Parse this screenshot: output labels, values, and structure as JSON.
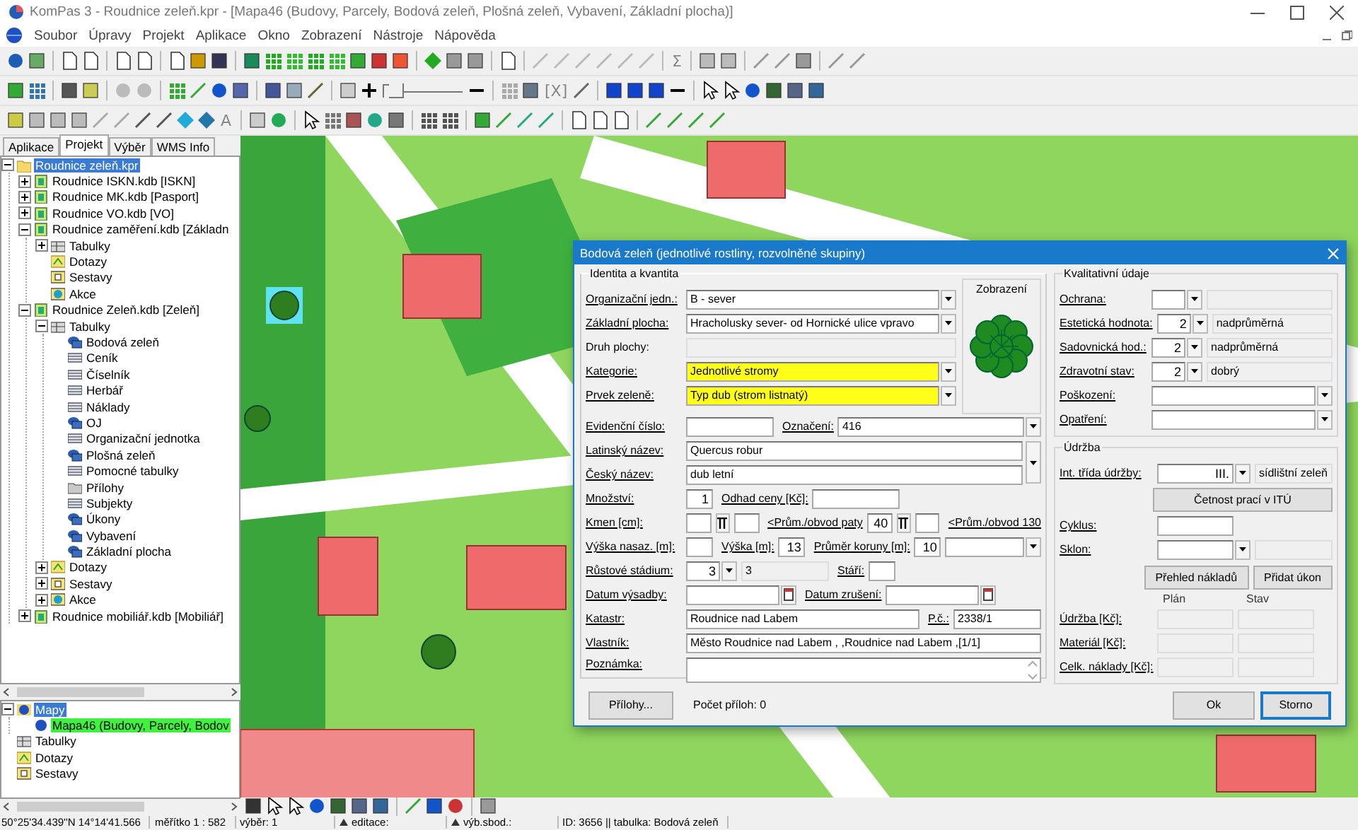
{
  "window": {
    "title": "KomPas 3 - Roudnice zeleň.kpr - [Mapa46 (Budovy, Parcely, Bodová zeleň, Plošná zeleň, Vybavení, Základní plocha)]"
  },
  "menu": [
    "Soubor",
    "Úpravy",
    "Projekt",
    "Aplikace",
    "Okno",
    "Zobrazení",
    "Nástroje",
    "Nápověda"
  ],
  "toolbars": [
    {
      "glyphs": [
        "Σ"
      ]
    },
    {
      "glyphs": [
        "[X]"
      ]
    },
    {
      "glyphs": [
        "A"
      ]
    }
  ],
  "tabs": [
    {
      "label": "Aplikace",
      "selected": false
    },
    {
      "label": "Projekt",
      "selected": true
    },
    {
      "label": "Výběr",
      "selected": false
    },
    {
      "label": "WMS Info",
      "selected": false
    }
  ],
  "project_tree": [
    {
      "label": "Roudnice zeleň.kpr",
      "kind": "folder",
      "expanded": true,
      "selected": true,
      "children": [
        {
          "label": "Roudnice ISKN.kdb [ISKN]",
          "kind": "database",
          "expanded": false,
          "selected": false
        },
        {
          "label": "Roudnice MK.kdb [Pasport]",
          "kind": "database",
          "expanded": false,
          "selected": false
        },
        {
          "label": "Roudnice VO.kdb [VO]",
          "kind": "database",
          "expanded": false,
          "selected": false
        },
        {
          "label": "Roudnice zaměření.kdb [Základn",
          "kind": "database",
          "expanded": true,
          "selected": false,
          "children": [
            {
              "label": "Tabulky",
              "kind": "tables",
              "expanded": false,
              "selected": false
            },
            {
              "label": "Dotazy",
              "kind": "query",
              "selected": false
            },
            {
              "label": "Sestavy",
              "kind": "report",
              "selected": false
            },
            {
              "label": "Akce",
              "kind": "action",
              "selected": false
            }
          ]
        },
        {
          "label": "Roudnice Zeleň.kdb [Zeleň]",
          "kind": "database",
          "expanded": true,
          "selected": false,
          "children": [
            {
              "label": "Tabulky",
              "kind": "tables",
              "expanded": true,
              "selected": false,
              "children": [
                {
                  "label": "Bodová zeleň",
                  "kind": "layer",
                  "selected": false
                },
                {
                  "label": "Ceník",
                  "kind": "table",
                  "selected": false
                },
                {
                  "label": "Číselník",
                  "kind": "table",
                  "selected": false
                },
                {
                  "label": "Herbář",
                  "kind": "table",
                  "selected": false
                },
                {
                  "label": "Náklady",
                  "kind": "table",
                  "selected": false
                },
                {
                  "label": "OJ",
                  "kind": "layer",
                  "selected": false
                },
                {
                  "label": "Organizační jednotka",
                  "kind": "table",
                  "selected": false
                },
                {
                  "label": "Plošná zeleň",
                  "kind": "layer",
                  "selected": false
                },
                {
                  "label": "Pomocné tabulky",
                  "kind": "table",
                  "selected": false
                },
                {
                  "label": "Přílohy",
                  "kind": "attachment",
                  "selected": false
                },
                {
                  "label": "Subjekty",
                  "kind": "table",
                  "selected": false
                },
                {
                  "label": "Úkony",
                  "kind": "layer",
                  "selected": false
                },
                {
                  "label": "Vybavení",
                  "kind": "layer",
                  "selected": false
                },
                {
                  "label": "Základní plocha",
                  "kind": "layer",
                  "selected": false
                }
              ]
            },
            {
              "label": "Dotazy",
              "kind": "query",
              "expanded": false,
              "selected": false
            },
            {
              "label": "Sestavy",
              "kind": "report",
              "expanded": false,
              "selected": false
            },
            {
              "label": "Akce",
              "kind": "action",
              "expanded": false,
              "selected": false
            }
          ]
        },
        {
          "label": "Roudnice mobiliář.kdb [Mobiliář]",
          "kind": "database",
          "expanded": false,
          "selected": false
        }
      ]
    }
  ],
  "map_tree": [
    {
      "label": "Mapy",
      "kind": "maps",
      "expanded": true,
      "selected": true,
      "children": [
        {
          "label": "Mapa46 (Budovy, Parcely, Bodov",
          "kind": "map",
          "selected": false,
          "active": true
        }
      ]
    },
    {
      "label": "Tabulky",
      "kind": "tables",
      "selected": false
    },
    {
      "label": "Dotazy",
      "kind": "query",
      "selected": false
    },
    {
      "label": "Sestavy",
      "kind": "report",
      "selected": false
    }
  ],
  "dialog": {
    "title": "Bodová zeleň (jednotlivé rostliny, rozvolněné skupiny)",
    "identity": {
      "legend": "Identita a kvantita",
      "top_rows": [
        {
          "cells": [
            {
              "kind": "label",
              "text": "Organizační jedn.:",
              "link": true
            },
            {
              "kind": "combo",
              "value": "B - sever"
            }
          ]
        },
        {
          "cells": [
            {
              "kind": "label",
              "text": "Základní plocha:",
              "link": true
            },
            {
              "kind": "combo",
              "value": "Hracholusky sever- od Hornické ulice vpravo"
            }
          ]
        },
        {
          "cells": [
            {
              "kind": "label",
              "text": "Druh plochy:",
              "link": false
            },
            {
              "kind": "text",
              "disabled": true
            }
          ]
        },
        {
          "cells": [
            {
              "kind": "label",
              "text": "Kategorie:",
              "link": true
            },
            {
              "kind": "combo",
              "value": "Jednotlivé stromy",
              "required": true
            }
          ]
        },
        {
          "cells": [
            {
              "kind": "label",
              "text": "Prvek zeleně:",
              "link": true
            },
            {
              "kind": "combo",
              "value": "Typ dub (strom listnatý)",
              "required": true
            }
          ]
        }
      ],
      "rows": [
        {
          "cells": [
            {
              "kind": "label",
              "text": "Evidenční číslo:",
              "link": true
            },
            {
              "kind": "field"
            },
            {
              "kind": "label",
              "text": "Označení:",
              "link": true
            },
            {
              "kind": "combo",
              "value": "416"
            }
          ]
        },
        {
          "stack": [
            [
              {
                "kind": "label",
                "text": "Latinský název:",
                "link": true
              },
              {
                "kind": "text",
                "value": "Quercus robur"
              }
            ],
            [
              {
                "kind": "label",
                "text": "Český název:",
                "link": true
              },
              {
                "kind": "text",
                "value": "dub letní"
              }
            ]
          ]
        },
        {
          "cells": [
            {
              "kind": "label",
              "text": "Množství:",
              "link": true
            },
            {
              "kind": "num",
              "value": "1"
            },
            {
              "kind": "label",
              "text": "Odhad ceny [Kč]:",
              "link": true
            },
            {
              "kind": "field"
            }
          ]
        },
        {
          "cells": [
            {
              "kind": "label",
              "text": "Kmen [cm]:",
              "link": true
            },
            {
              "kind": "num"
            },
            {
              "kind": "toggle"
            },
            {
              "kind": "num"
            },
            {
              "kind": "label",
              "text": "<Prům./obvod paty",
              "link": true
            },
            {
              "kind": "num",
              "value": "40"
            },
            {
              "kind": "toggle"
            },
            {
              "kind": "num"
            },
            {
              "kind": "label",
              "text": "<Prům./obvod 130",
              "link": true
            }
          ]
        },
        {
          "cells": [
            {
              "kind": "label",
              "text": "Výška nasaz. [m]:",
              "link": true
            },
            {
              "kind": "num"
            },
            {
              "kind": "label",
              "text": "Výška [m]:",
              "link": true
            },
            {
              "kind": "num",
              "value": "13"
            },
            {
              "kind": "label",
              "text": "Průměr koruny [m]:",
              "link": true
            },
            {
              "kind": "num",
              "value": "10"
            },
            {
              "kind": "combo"
            }
          ]
        },
        {
          "cells": [
            {
              "kind": "label",
              "text": "Růstové stádium:",
              "link": true
            },
            {
              "kind": "code",
              "value": "3"
            },
            {
              "kind": "field",
              "value": "3",
              "disabled": true
            },
            {
              "kind": "label",
              "text": "Stáří:",
              "link": true
            },
            {
              "kind": "num"
            }
          ]
        },
        {
          "cells": [
            {
              "kind": "label",
              "text": "Datum výsadby:",
              "link": true
            },
            {
              "kind": "date"
            },
            {
              "kind": "label",
              "text": "Datum zrušení:",
              "link": true
            },
            {
              "kind": "date"
            }
          ]
        },
        {
          "cells": [
            {
              "kind": "label",
              "text": "Katastr:",
              "link": true
            },
            {
              "kind": "text",
              "value": "Roudnice nad Labem"
            },
            {
              "kind": "label",
              "text": "P.č.:",
              "link": true
            },
            {
              "kind": "field",
              "value": "2338/1"
            }
          ]
        },
        {
          "cells": [
            {
              "kind": "label",
              "text": "Vlastník:",
              "link": true
            },
            {
              "kind": "text",
              "value": "Město Roudnice nad Labem , ,Roudnice nad Labem ,[1/1]"
            }
          ]
        },
        {
          "cells": [
            {
              "kind": "label",
              "text": "Poznámka:",
              "link": true
            },
            {
              "kind": "memo"
            }
          ]
        }
      ]
    },
    "preview": {
      "legend": "Zobrazení"
    },
    "quality": {
      "legend": "Kvalitativní údaje",
      "rows": [
        {
          "cells": [
            {
              "kind": "label",
              "text": "Ochrana:",
              "link": true
            },
            {
              "kind": "code"
            },
            {
              "kind": "text",
              "disabled": true
            }
          ]
        },
        {
          "cells": [
            {
              "kind": "label",
              "text": "Estetická hodnota:",
              "link": true
            },
            {
              "kind": "code",
              "value": "2"
            },
            {
              "kind": "text",
              "value": "nadprůměrná",
              "disabled": true
            }
          ]
        },
        {
          "cells": [
            {
              "kind": "label",
              "text": "Sadovnická hod.:",
              "link": true
            },
            {
              "kind": "code",
              "value": "2"
            },
            {
              "kind": "text",
              "value": "nadprůměrná",
              "disabled": true
            }
          ]
        },
        {
          "cells": [
            {
              "kind": "label",
              "text": "Zdravotní stav:",
              "link": true
            },
            {
              "kind": "code",
              "value": "2"
            },
            {
              "kind": "text",
              "value": "dobrý",
              "disabled": true
            }
          ]
        },
        {
          "cells": [
            {
              "kind": "label",
              "text": "Poškození:",
              "link": true
            },
            {
              "kind": "combo"
            }
          ]
        },
        {
          "cells": [
            {
              "kind": "label",
              "text": "Opatření:",
              "link": true
            },
            {
              "kind": "combo"
            }
          ]
        }
      ]
    },
    "maintenance": {
      "legend": "Údržba",
      "rows": [
        {
          "cells": [
            {
              "kind": "label",
              "text": "Int. třída údržby:",
              "link": true
            },
            {
              "kind": "code",
              "value": "III."
            },
            {
              "kind": "text",
              "value": "sídlištní zeleň",
              "disabled": true
            }
          ]
        },
        {
          "cells": [
            {
              "kind": "button",
              "text": "Četnost prací v ITÚ"
            }
          ]
        },
        {
          "cells": [
            {
              "kind": "label",
              "text": "Cyklus:",
              "link": true
            },
            {
              "kind": "num"
            }
          ]
        },
        {
          "cells": [
            {
              "kind": "label",
              "text": "Sklon:",
              "link": true
            },
            {
              "kind": "code"
            },
            {
              "kind": "text",
              "disabled": true
            }
          ]
        },
        {
          "cells": [
            {
              "kind": "button",
              "text": "Přehled nákladů"
            },
            {
              "kind": "button",
              "text": "Přidat úkon"
            }
          ]
        },
        {
          "cells": [
            {
              "kind": "heading",
              "text": "Plán"
            },
            {
              "kind": "heading",
              "text": "Stav"
            }
          ]
        },
        {
          "cells": [
            {
              "kind": "label",
              "text": "Údržba [Kč]:",
              "link": true
            },
            {
              "kind": "field",
              "disabled": true
            },
            {
              "kind": "field",
              "disabled": true
            }
          ]
        },
        {
          "cells": [
            {
              "kind": "label",
              "text": "Materiál [Kč]:",
              "link": true
            },
            {
              "kind": "field",
              "disabled": true
            },
            {
              "kind": "field",
              "disabled": true
            }
          ]
        },
        {
          "cells": [
            {
              "kind": "label",
              "text": "Celk. náklady [Kč]:",
              "link": true
            },
            {
              "kind": "field",
              "disabled": true
            },
            {
              "kind": "field",
              "disabled": true
            }
          ]
        }
      ]
    },
    "attachments_button": "Přílohy...",
    "attachments_count": "Počet příloh: 0",
    "buttons": [
      {
        "label": "Ok",
        "default": false
      },
      {
        "label": "Storno",
        "default": true
      }
    ]
  },
  "status_bar": [
    "50°25'34.439''N 14°14'41.566",
    "měřítko 1 : 582",
    "výběr: 1",
    "editace:",
    "výb.sbod.:",
    "ID: 3656 || tabulka: Bodová zeleň"
  ]
}
